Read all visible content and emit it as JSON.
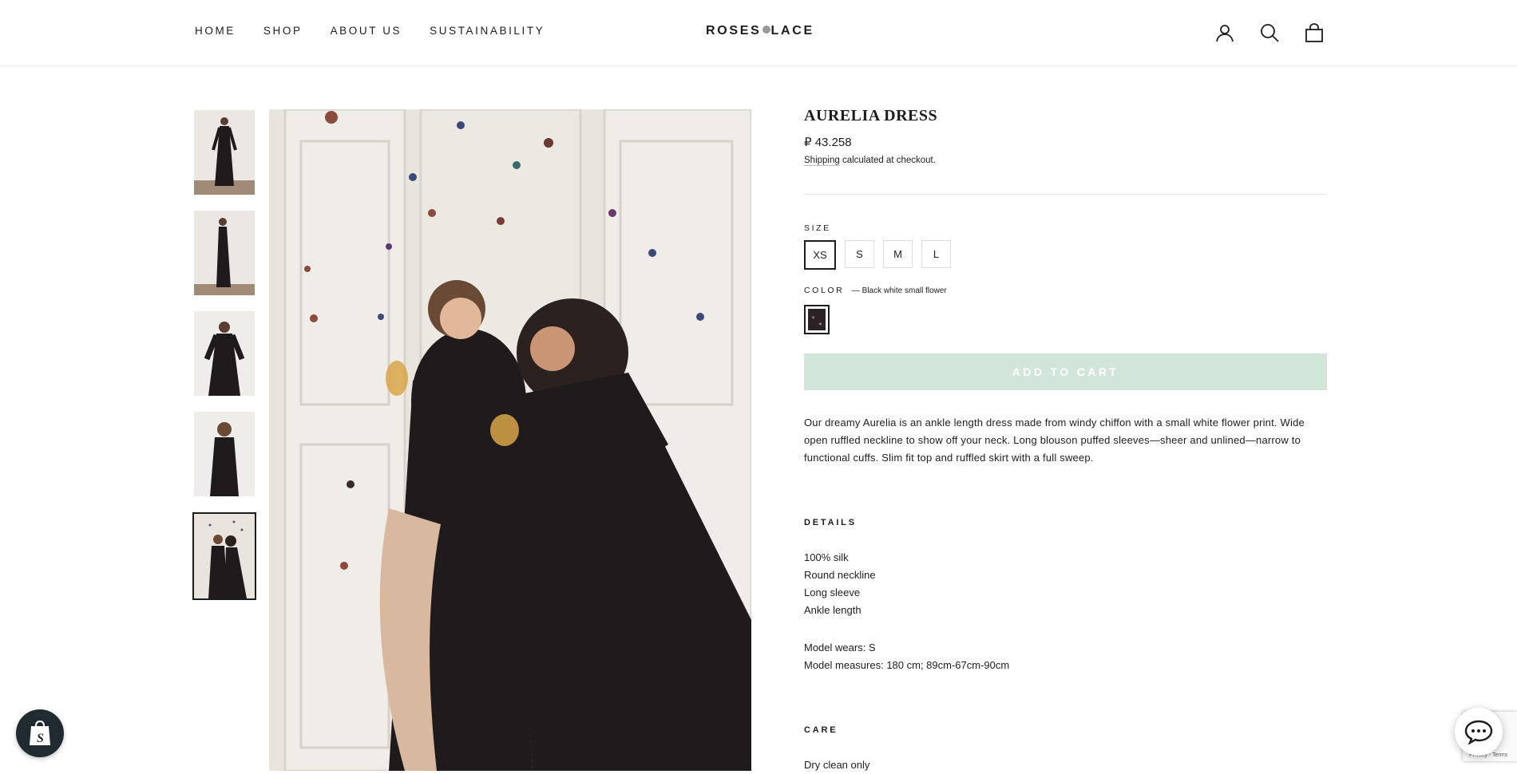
{
  "header": {
    "nav": [
      "HOME",
      "SHOP",
      "ABOUT US",
      "SUSTAINABILITY"
    ],
    "logo_left": "ROSES",
    "logo_right": "LACE"
  },
  "product": {
    "title": "AURELIA DRESS",
    "price": "₽ 43.258",
    "shipping_link": "Shipping",
    "shipping_rest": " calculated at checkout.",
    "size_label": "SIZE",
    "sizes": [
      "XS",
      "S",
      "M",
      "L"
    ],
    "selected_size": "XS",
    "color_label": "COLOR",
    "color_value": "— Black white small flower",
    "add_to_cart": "ADD TO CART",
    "description": "Our dreamy Aurelia is an ankle length dress made from windy chiffon with a small white flower print. Wide open ruffled neckline to show off your neck. Long blouson puffed sleeves—sheer and unlined—narrow to functional cuffs. Slim fit top and ruffled skirt with a full sweep.",
    "details_label": "DETAILS",
    "details": [
      "100% silk",
      "Round neckline",
      "Long sleeve",
      "Ankle length"
    ],
    "model": [
      "Model wears: S",
      "Model measures: 180 cm; 89cm-67cm-90cm"
    ],
    "care_label": "CARE",
    "care": "Dry clean only"
  },
  "recaptcha": "Privacy - Terms",
  "colors": {
    "accent_disabled": "#d2e5d9",
    "text": "#1c1d1d",
    "dress": "#1f1a1c",
    "wall": "#e9e5de"
  }
}
